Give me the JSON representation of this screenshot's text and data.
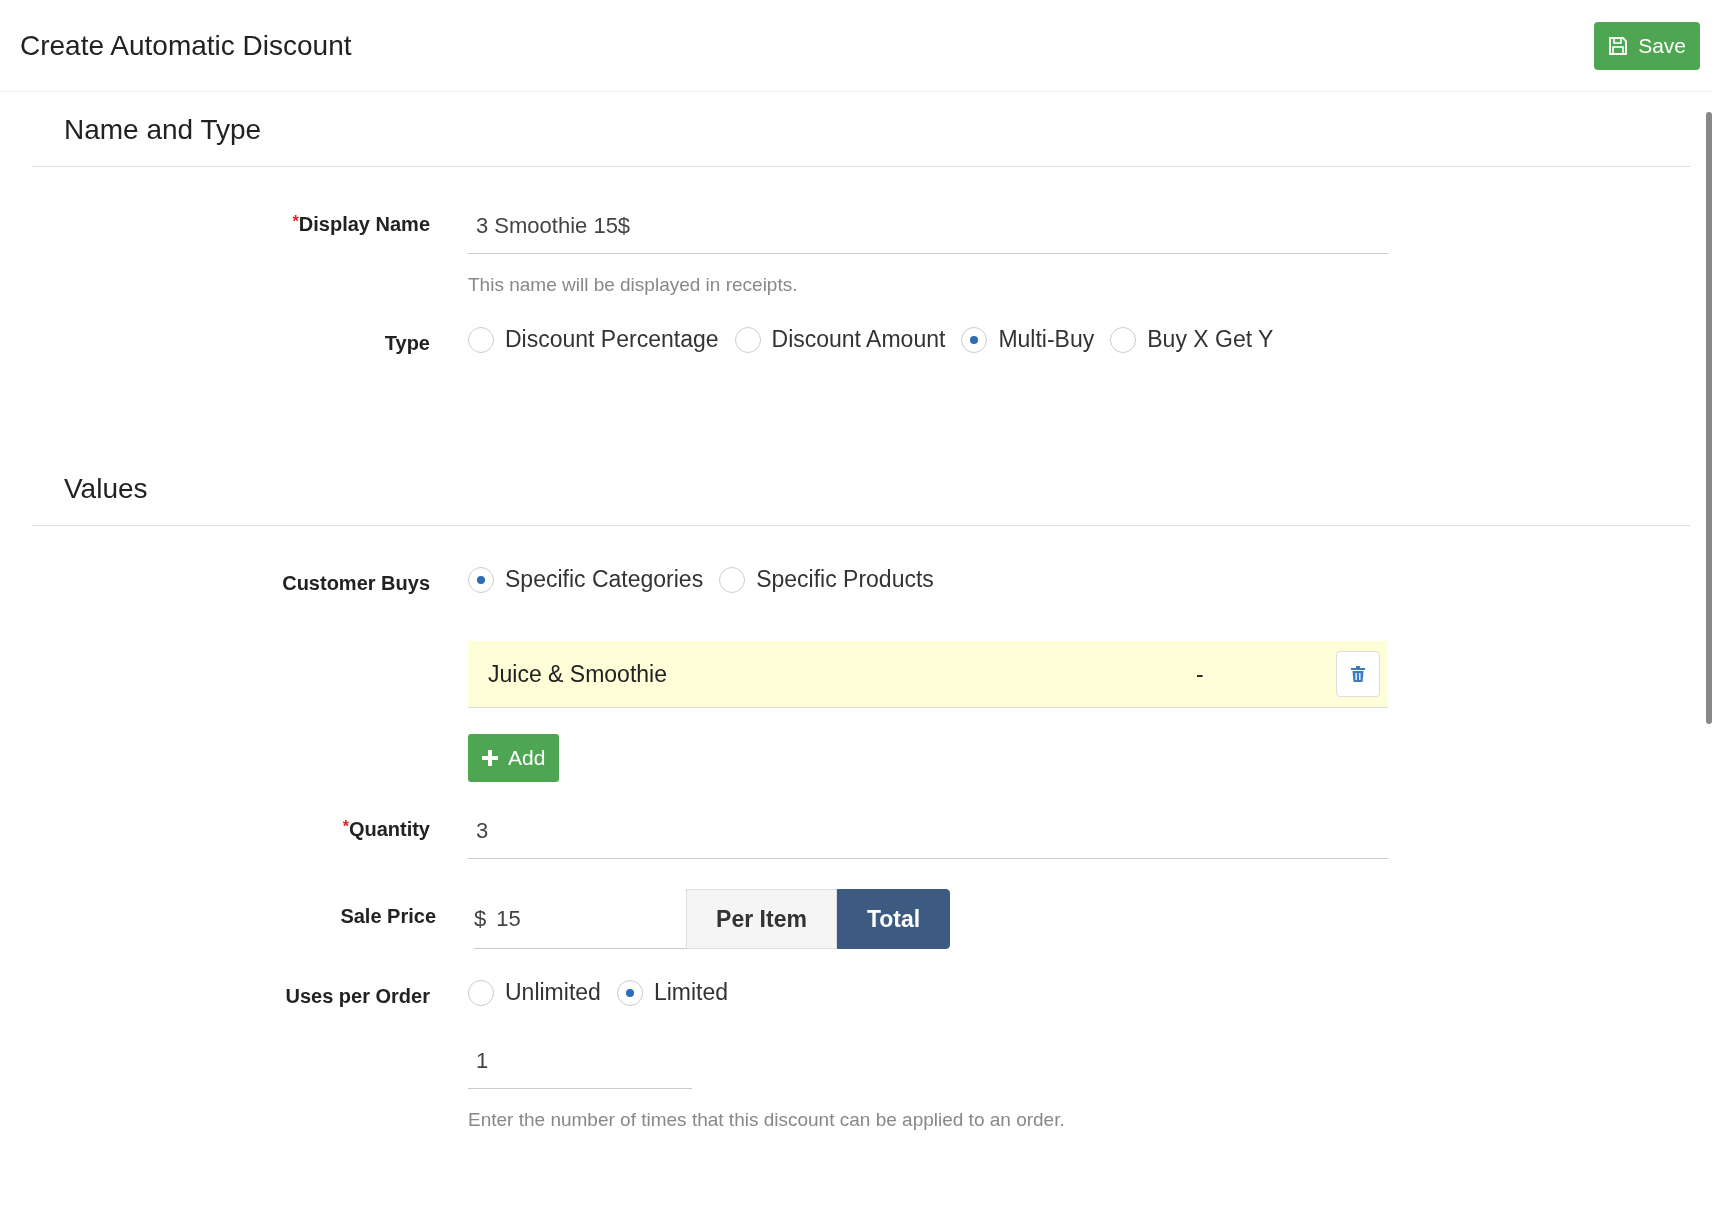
{
  "header": {
    "title": "Create Automatic Discount",
    "save_button": "Save"
  },
  "sections": [
    {
      "title": "Name and Type",
      "fields": [
        {
          "kind": "text",
          "label": "Display Name",
          "required_mark": "*",
          "value": "3 Smoothie 15$",
          "help": "This name will be displayed in receipts."
        },
        {
          "kind": "radio",
          "label": "Type",
          "options": [
            {
              "label": "Discount Percentage",
              "selected": false
            },
            {
              "label": "Discount Amount",
              "selected": false
            },
            {
              "label": "Multi-Buy",
              "selected": true
            },
            {
              "label": "Buy X Get Y",
              "selected": false
            }
          ]
        }
      ]
    },
    {
      "title": "Values",
      "fields": [
        {
          "kind": "radio",
          "label": "Customer Buys",
          "options": [
            {
              "label": "Specific Categories",
              "selected": true
            },
            {
              "label": "Specific Products",
              "selected": false
            }
          ]
        },
        {
          "kind": "list",
          "items": [
            {
              "name": "Juice & Smoothie",
              "column_2": "-"
            }
          ],
          "add_button": "Add"
        },
        {
          "kind": "text",
          "label": "Quantity",
          "required_mark": "*",
          "value": "3"
        },
        {
          "kind": "price",
          "label": "Sale Price",
          "prefix": "$",
          "value": "15",
          "toggle": [
            {
              "label": "Per Item",
              "selected": false
            },
            {
              "label": "Total",
              "selected": true
            }
          ]
        },
        {
          "kind": "radio",
          "label": "Uses per Order",
          "options": [
            {
              "label": "Unlimited",
              "selected": false
            },
            {
              "label": "Limited",
              "selected": true
            }
          ]
        },
        {
          "kind": "short",
          "value": "1",
          "help": "Enter the number of times that this discount can be applied to an order."
        }
      ]
    }
  ]
}
